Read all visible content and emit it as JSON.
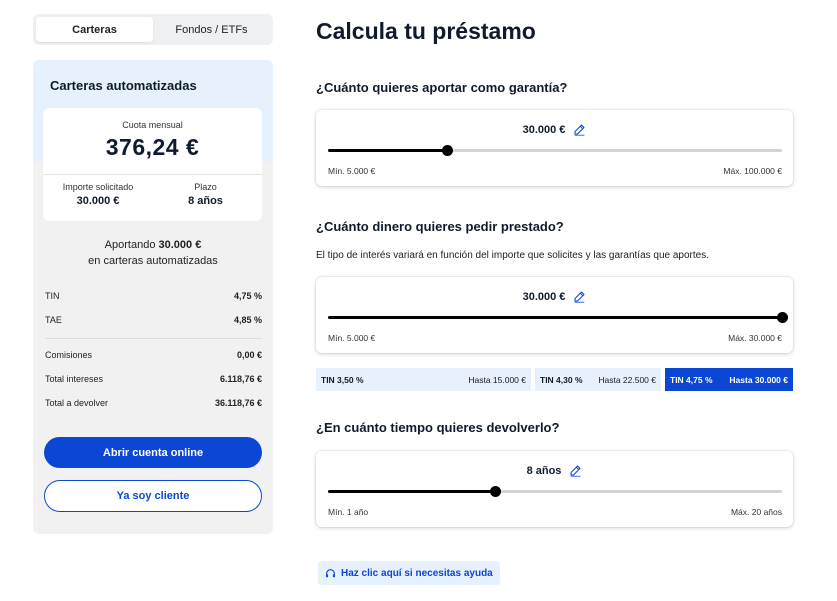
{
  "tabs": [
    {
      "label": "Carteras",
      "active": true
    },
    {
      "label": "Fondos / ETFs",
      "active": false
    }
  ],
  "summary": {
    "title": "Carteras automatizadas",
    "cuota_label": "Cuota mensual",
    "cuota_value": "376,24 €",
    "importe_label": "Importe solicitado",
    "importe_value": "30.000 €",
    "plazo_label": "Plazo",
    "plazo_value": "8 años",
    "aport_prefix": "Aportando",
    "aport_amount": "30.000 €",
    "aport_suffix": "en carteras automatizadas",
    "rows": [
      {
        "label": "TIN",
        "value": "4,75 %"
      },
      {
        "label": "TAE",
        "value": "4,85 %"
      },
      {
        "label": "Comisiones",
        "value": "0,00 €"
      },
      {
        "label": "Total intereses",
        "value": "6.118,76 €"
      },
      {
        "label": "Total a devolver",
        "value": "36.118,76 €"
      }
    ],
    "primary_button": "Abrir cuenta online",
    "secondary_button": "Ya soy cliente"
  },
  "main": {
    "title": "Calcula tu préstamo",
    "garantia": {
      "question": "¿Cuánto quieres aportar como garantía?",
      "value": "30.000 €",
      "min_label": "Mín. 5.000 €",
      "max_label": "Máx. 100.000 €",
      "position": 0.2632
    },
    "prestamo": {
      "question": "¿Cuánto dinero quieres pedir prestado?",
      "description": "El tipo de interés variará en función del importe que solicites y las garantías que aportes.",
      "value": "30.000 €",
      "min_label": "Mín. 5.000 €",
      "max_label": "Máx. 30.000 €",
      "position": 1.0
    },
    "tramos": [
      {
        "tin": "TIN 3,50 %",
        "hasta": "Hasta 15.000 €",
        "active": false
      },
      {
        "tin": "TIN 4,30 %",
        "hasta": "Hasta 22.500 €",
        "active": false
      },
      {
        "tin": "TIN 4,75 %",
        "hasta": "Hasta 30.000 €",
        "active": true
      }
    ],
    "plazo": {
      "question": "¿En cuánto tiempo quieres devolverlo?",
      "value": "8 años",
      "min_label": "Mín. 1 año",
      "max_label": "Máx. 20 años",
      "position": 0.3684
    },
    "help_link": "Haz clic aquí si necesitas ayuda"
  },
  "colors": {
    "accent": "#0b47d4",
    "light_accent": "#e7f0fd",
    "panel_bg": "#f1f1f1",
    "text": "#0f1b2d"
  },
  "icons": {
    "edit": "pencil-icon",
    "help": "headset-icon"
  }
}
